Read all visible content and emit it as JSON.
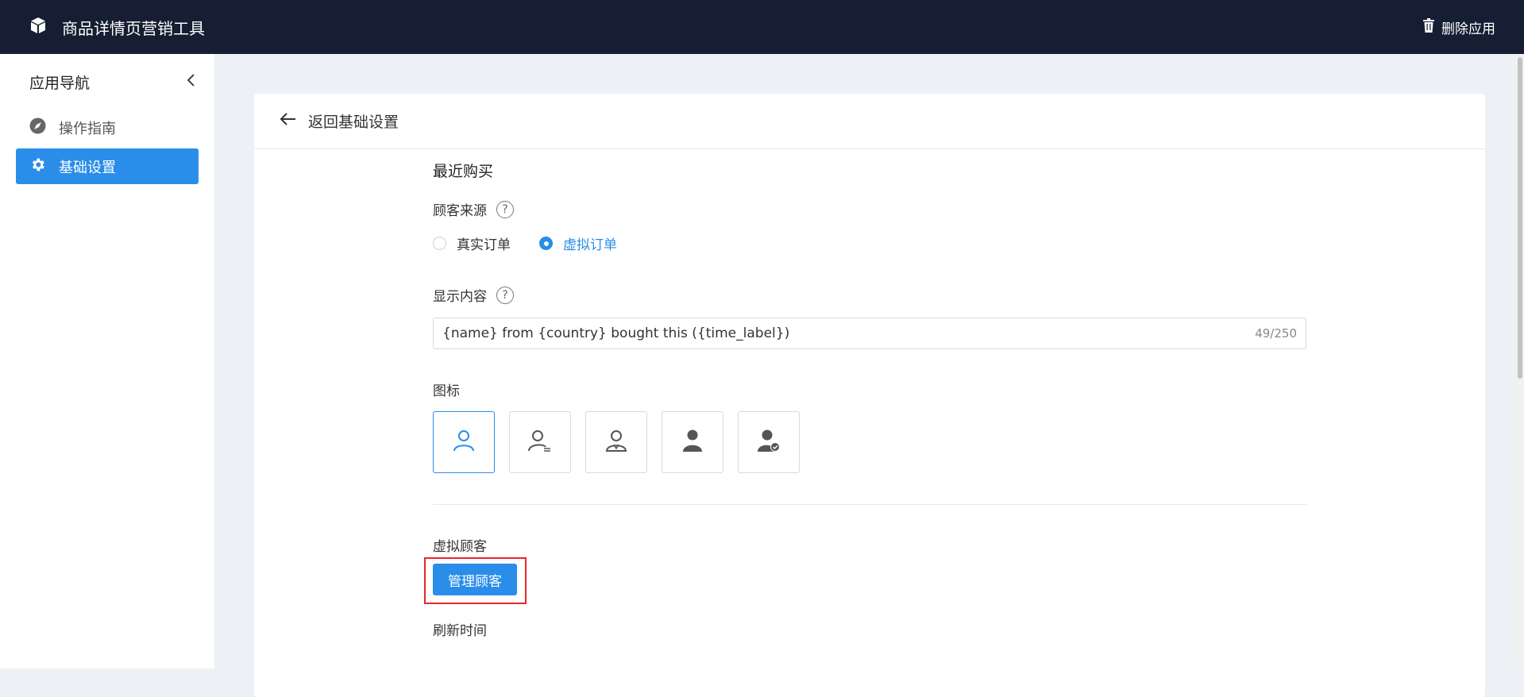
{
  "topbar": {
    "title": "商品详情页营销工具",
    "delete_label": "删除应用"
  },
  "sidebar": {
    "heading": "应用导航",
    "items": [
      {
        "label": "操作指南",
        "icon": "compass-icon",
        "active": false
      },
      {
        "label": "基础设置",
        "icon": "gear-icon",
        "active": true
      }
    ]
  },
  "card": {
    "back_label": "返回基础设置"
  },
  "form": {
    "section_title": "最近购买",
    "customer_source": {
      "label": "顾客来源",
      "options": [
        "真实订单",
        "虚拟订单"
      ],
      "selected": "虚拟订单"
    },
    "display_content": {
      "label": "显示内容",
      "value": "{name} from {country} bought this  ({time_label})",
      "count": "49/250"
    },
    "icon_field": {
      "label": "图标",
      "options": [
        "person-outline-icon",
        "person-list-icon",
        "person-badge-icon",
        "person-filled-icon",
        "person-check-icon"
      ],
      "selected_index": 0
    },
    "virtual_customers": {
      "label": "虚拟顾客",
      "button_label": "管理顾客"
    },
    "refresh_time": {
      "label": "刷新时间"
    }
  },
  "colors": {
    "topbar_bg": "#161e33",
    "accent": "#2a8de9",
    "highlight": "#e8262a",
    "page_bg": "#edf0f5"
  }
}
